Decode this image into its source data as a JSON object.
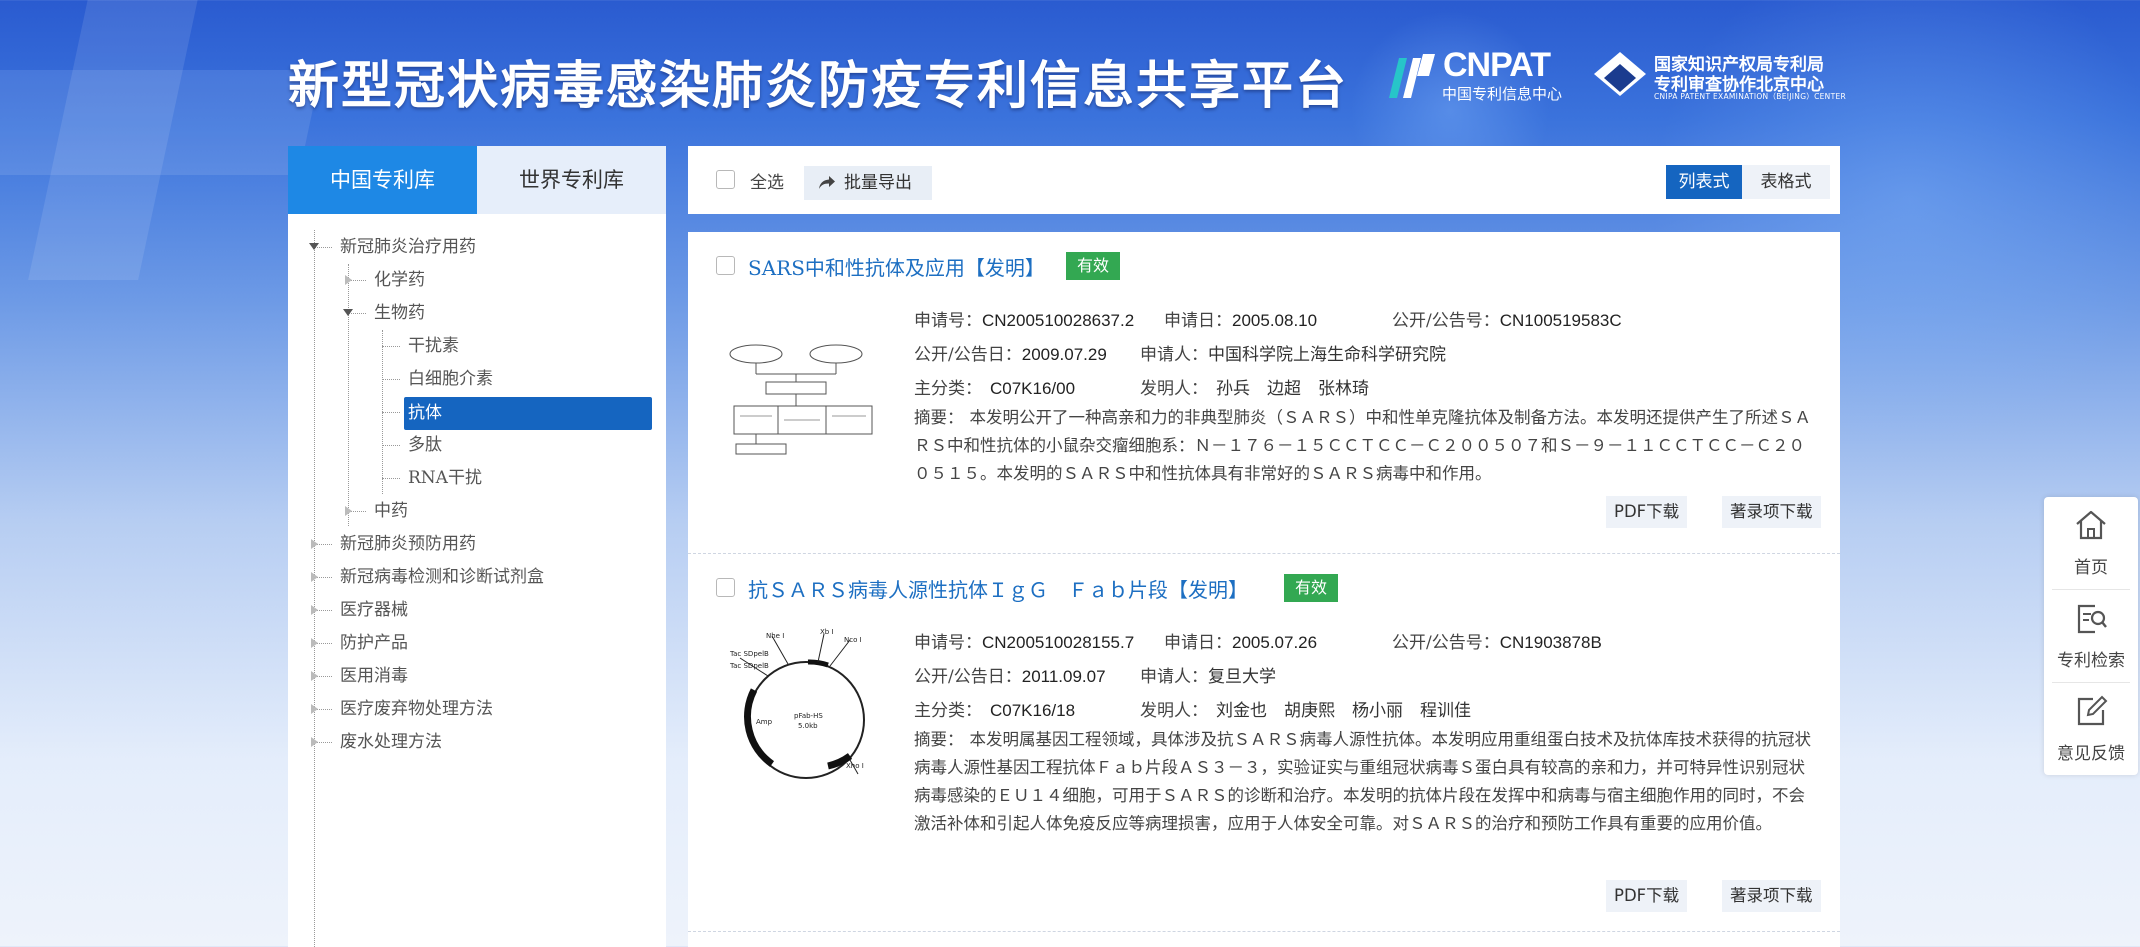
{
  "header": {
    "title": "新型冠状病毒感染肺炎防疫专利信息共享平台",
    "logo_cnpat": {
      "text": "CNPAT",
      "subtitle": "中国专利信息中心"
    },
    "logo_cnipa": {
      "line1": "国家知识产权局专利局",
      "line2": "专利审查协作北京中心",
      "line3": "CNIPA PATENT EXAMINATION（BEIJING）CENTER"
    }
  },
  "sidebar": {
    "tabs": [
      {
        "label": "中国专利库",
        "active": true
      },
      {
        "label": "世界专利库",
        "active": false
      }
    ],
    "tree": [
      {
        "label": "新冠肺炎治疗用药",
        "level": 0,
        "expanded": true
      },
      {
        "label": "化学药",
        "level": 1,
        "expanded": false
      },
      {
        "label": "生物药",
        "level": 1,
        "expanded": true
      },
      {
        "label": "干扰素",
        "level": 2
      },
      {
        "label": "白细胞介素",
        "level": 2
      },
      {
        "label": "抗体",
        "level": 2,
        "selected": true
      },
      {
        "label": "多肽",
        "level": 2
      },
      {
        "label": "RNA干扰",
        "level": 2
      },
      {
        "label": "中药",
        "level": 1,
        "expanded": false
      },
      {
        "label": "新冠肺炎预防用药",
        "level": 0
      },
      {
        "label": "新冠病毒检测和诊断试剂盒",
        "level": 0
      },
      {
        "label": "医疗器械",
        "level": 0
      },
      {
        "label": "防护产品",
        "level": 0
      },
      {
        "label": "医用消毒",
        "level": 0
      },
      {
        "label": "医疗废弃物处理方法",
        "level": 0
      },
      {
        "label": "废水处理方法",
        "level": 0
      }
    ]
  },
  "toolbar": {
    "select_all_label": "全选",
    "export_label": "批量导出",
    "view_list_label": "列表式",
    "view_table_label": "表格式"
  },
  "labels": {
    "app_no": "申请号：",
    "app_date": "申请日：",
    "pub_no": "公开/公告号：",
    "pub_date": "公开/公告日：",
    "applicant": "申请人：",
    "main_class": "主分类：",
    "inventor": "发明人：",
    "abstract": "摘要："
  },
  "records": [
    {
      "title": "SARS中和性抗体及应用",
      "type": "【发明】",
      "status": "有效",
      "app_no": "CN200510028637.2",
      "app_date": "2005.08.10",
      "pub_no": "CN100519583C",
      "pub_date": "2009.07.29",
      "applicant": "中国科学院上海生命科学研究院",
      "main_class": "C07K16/00",
      "inventor": "孙兵　边超　张林琦",
      "abstract": "本发明公开了一种高亲和力的非典型肺炎（ＳＡＲＳ）中和性单克隆抗体及制备方法。本发明还提供产生了所述ＳＡＲＳ中和性抗体的小鼠杂交瘤细胞系：Ｎ－１７６－１５ＣＣＴＣＣ－Ｃ２００５０７和Ｓ－９－１１ＣＣＴＣＣ－Ｃ２００５１５。本发明的ＳＡＲＳ中和性抗体具有非常好的ＳＡＲＳ病毒中和作用。",
      "pdf_label": "PDF下载",
      "biblio_label": "著录项下载"
    },
    {
      "title": "抗ＳＡＲＳ病毒人源性抗体ＩｇＧ　Ｆａｂ片段",
      "type": "【发明】",
      "status": "有效",
      "app_no": "CN200510028155.7",
      "app_date": "2005.07.26",
      "pub_no": "CN1903878B",
      "pub_date": "2011.09.07",
      "applicant": "复旦大学",
      "main_class": "C07K16/18",
      "inventor": "刘金也　胡庚熙　杨小丽　程训佳",
      "abstract": "本发明属基因工程领域，具体涉及抗ＳＡＲＳ病毒人源性抗体。本发明应用重组蛋白技术及抗体库技术获得的抗冠状病毒人源性基因工程抗体Ｆａｂ片段ＡＳ３－３，实验证实与重组冠状病毒Ｓ蛋白具有较高的亲和力，并可特异性识别冠状病毒感染的ＥＵ１４细胞，可用于ＳＡＲＳ的诊断和治疗。本发明的抗体片段在发挥中和病毒与宿主细胞作用的同时，不会激活补体和引起人体免疫反应等病理损害，应用于人体安全可靠。对ＳＡＲＳ的治疗和预防工作具有重要的应用价值。",
      "pdf_label": "PDF下载",
      "biblio_label": "著录项下载"
    }
  ],
  "float_bar": {
    "home_label": "首页",
    "search_label": "专利检索",
    "feedback_label": "意见反馈"
  },
  "colors": {
    "primary": "#1565c0",
    "tab_active": "#1e88e5",
    "badge_valid": "#33a852",
    "link": "#1d6fc2"
  }
}
